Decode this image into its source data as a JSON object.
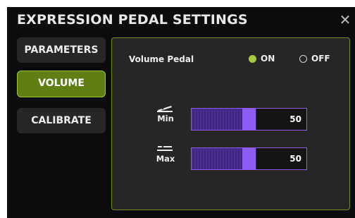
{
  "dialog": {
    "title": "EXPRESSION PEDAL SETTINGS",
    "close_icon": "close-icon"
  },
  "nav": {
    "items": [
      {
        "label": "PARAMETERS",
        "active": false
      },
      {
        "label": "VOLUME",
        "active": true
      },
      {
        "label": "CALIBRATE",
        "active": false
      }
    ]
  },
  "volume_pedal": {
    "label": "Volume Pedal",
    "options": [
      {
        "label": "ON",
        "selected": true
      },
      {
        "label": "OFF",
        "selected": false
      }
    ]
  },
  "sliders": {
    "min": {
      "label": "Min",
      "value": "50",
      "icon": "pedal-heel-icon"
    },
    "max": {
      "label": "Max",
      "value": "50",
      "icon": "pedal-toe-icon"
    }
  },
  "colors": {
    "accent_green": "#9bc63a",
    "accent_purple": "#8b5cf6",
    "background": "#0c0c0c",
    "panel": "#262626"
  }
}
